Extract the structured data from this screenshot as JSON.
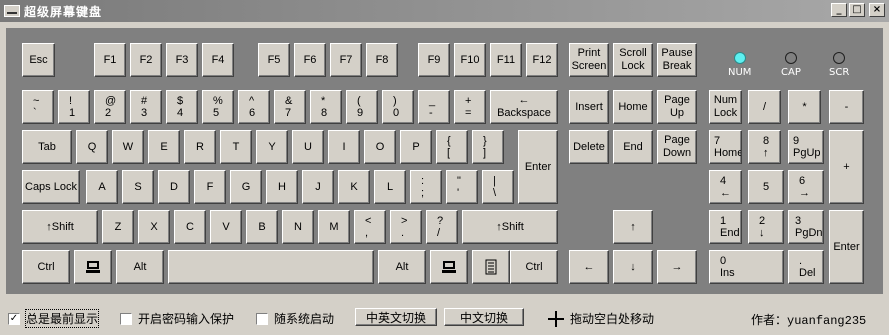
{
  "window": {
    "title": "超级屏幕键盘",
    "buttons": [
      "_",
      "□",
      "×"
    ]
  },
  "indicators": [
    {
      "label": "NUM",
      "on": true
    },
    {
      "label": "CAP",
      "on": false
    },
    {
      "label": "SCR",
      "on": false
    }
  ],
  "keys": {
    "esc": "Esc",
    "f1": "F1",
    "f2": "F2",
    "f3": "F3",
    "f4": "F4",
    "f5": "F5",
    "f6": "F6",
    "f7": "F7",
    "f8": "F8",
    "f9": "F9",
    "f10": "F10",
    "f11": "F11",
    "f12": "F12",
    "print": "Print\nScreen",
    "scroll": "Scroll\nLock",
    "pause": "Pause\nBreak",
    "tilde": [
      "~",
      "`"
    ],
    "k1": [
      "!",
      "1"
    ],
    "k2": [
      "@",
      "2"
    ],
    "k3": [
      "#",
      "3"
    ],
    "k4": [
      "$",
      "4"
    ],
    "k5": [
      "%",
      "5"
    ],
    "k6": [
      "^",
      "6"
    ],
    "k7": [
      "&",
      "7"
    ],
    "k8": [
      "*",
      "8"
    ],
    "k9": [
      "(",
      "9"
    ],
    "k0": [
      ")",
      "0"
    ],
    "minus": [
      "_",
      "-"
    ],
    "equal": [
      "+",
      "="
    ],
    "backspace": [
      "←",
      "Backspace"
    ],
    "tab": "Tab",
    "q": "Q",
    "w": "W",
    "e": "E",
    "r": "R",
    "t": "T",
    "y": "Y",
    "u": "U",
    "i": "I",
    "o": "O",
    "p": "P",
    "lbracket": [
      "{",
      "["
    ],
    "rbracket": [
      "}",
      "]"
    ],
    "enter": "Enter",
    "caps": "Caps Lock",
    "a": "A",
    "s": "S",
    "d": "D",
    "f": "F",
    "g": "G",
    "h": "H",
    "j": "J",
    "k": "K",
    "l": "L",
    "semicolon": [
      ":",
      ";"
    ],
    "quote": [
      "\"",
      "'"
    ],
    "backslash": [
      "|",
      "\\"
    ],
    "lshift": "↑Shift",
    "z": "Z",
    "x": "X",
    "c": "C",
    "v": "V",
    "b": "B",
    "n": "N",
    "m": "M",
    "comma": [
      "<",
      ","
    ],
    "period": [
      ">",
      "."
    ],
    "slash": [
      "?",
      "/"
    ],
    "rshift": "↑Shift",
    "lctrl": "Ctrl",
    "lalt": "Alt",
    "ralt": "Alt",
    "rctrl": "Ctrl",
    "insert": "Insert",
    "home": "Home",
    "pageup": "Page\nUp",
    "delete": "Delete",
    "end": "End",
    "pagedown": "Page\nDown",
    "up": "↑",
    "left": "←",
    "down": "↓",
    "right": "→",
    "numlock": "Num\nLock",
    "npdiv": "/",
    "npmul": "*",
    "npminus": "-",
    "np7": [
      "7",
      "Home"
    ],
    "np8": [
      "8",
      "↑"
    ],
    "np9": [
      "9",
      "PgUp"
    ],
    "npplus": "+",
    "np4": [
      "4",
      "←"
    ],
    "np5": "5",
    "np6": [
      "6",
      "→"
    ],
    "np1": [
      "1",
      "End"
    ],
    "np2": [
      "2",
      "↓"
    ],
    "np3": [
      "3",
      "PgDn"
    ],
    "npenter": "Enter",
    "np0": [
      "0",
      "Ins"
    ],
    "npdot": [
      ".",
      "Del"
    ]
  },
  "bottom": {
    "always_on_top": {
      "label": "总是最前显示",
      "checked": true
    },
    "password_protect": {
      "label": "开启密码输入保护",
      "checked": false
    },
    "autostart": {
      "label": "随系统启动",
      "checked": false
    },
    "switch_cn_en": "中英文切换",
    "switch_cn": "中文切换",
    "drag_hint": "拖动空白处移动",
    "author_label": "作者：",
    "author_name": "yuanfang235"
  }
}
